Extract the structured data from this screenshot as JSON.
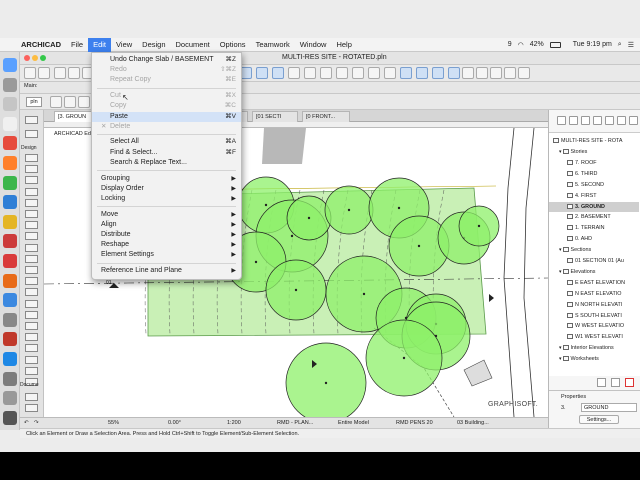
{
  "menubar": {
    "apple": "",
    "app": "ARCHICAD",
    "items": [
      "File",
      "Edit",
      "View",
      "Design",
      "Document",
      "Options",
      "Teamwork",
      "Window",
      "Help"
    ],
    "active": "Edit",
    "right": {
      "notif": "9",
      "battery": "42%",
      "flag": "",
      "time": "Tue 9:19 pm"
    }
  },
  "window": {
    "title": "MULTI-RES SITE - ROTATED.pln"
  },
  "toolbar3": {
    "zoom_select": "pln"
  },
  "toolbox": {
    "info_label": "Main:",
    "design_label": "Design",
    "document_label": "Docume",
    "more_label": "More"
  },
  "tabs": [
    {
      "label": "[3. GROUN",
      "active": true
    },
    {
      "label": "[A1000 Si",
      "active": false
    },
    {
      "label": "[A3000 SE",
      "active": false
    },
    {
      "label": "[0 N NOR",
      "active": false
    },
    {
      "label": "[01 SECTI",
      "active": false
    },
    {
      "label": "[0 FRONT...",
      "active": false
    }
  ],
  "canvas_labels": {
    "info": "ARCHICAD Edu",
    "grid_marker": "01",
    "logo": "GRAPHISOFT."
  },
  "status": {
    "undo": "",
    "zoom": "55%",
    "angle": "0.00°",
    "scale": "1:200",
    "layer_combo": "RMD - PLAN...",
    "model": "Entire Model",
    "pens": "RMD PENS 20",
    "view": "03 Building..."
  },
  "hint": "Click an Element or Draw a Selection Area. Press and Hold Ctrl+Shift to Toggle Element/Sub-Element Selection.",
  "navigator": {
    "root": "MULTI-RES SITE - ROTA",
    "tree": [
      {
        "label": "Stories",
        "level": 1,
        "selected": false
      },
      {
        "label": "7. ROOF",
        "level": 2,
        "selected": false
      },
      {
        "label": "6. THIRD",
        "level": 2,
        "selected": false
      },
      {
        "label": "5. SECOND",
        "level": 2,
        "selected": false
      },
      {
        "label": "4. FIRST",
        "level": 2,
        "selected": false
      },
      {
        "label": "3. GROUND",
        "level": 2,
        "selected": true
      },
      {
        "label": "2. BASEMENT",
        "level": 2,
        "selected": false
      },
      {
        "label": "1. TERRAIN",
        "level": 2,
        "selected": false
      },
      {
        "label": "0. AHD",
        "level": 2,
        "selected": false
      },
      {
        "label": "Sections",
        "level": 1,
        "selected": false
      },
      {
        "label": "01 SECTION 01 (Au",
        "level": 2,
        "selected": false
      },
      {
        "label": "Elevations",
        "level": 1,
        "selected": false
      },
      {
        "label": "E EAST ELEVATION",
        "level": 2,
        "selected": false
      },
      {
        "label": "N EAST ELEVATIO",
        "level": 2,
        "selected": false
      },
      {
        "label": "N NORTH ELEVATI",
        "level": 2,
        "selected": false
      },
      {
        "label": "S SOUTH ELEVATI",
        "level": 2,
        "selected": false
      },
      {
        "label": "W WEST ELEVATIO",
        "level": 2,
        "selected": false
      },
      {
        "label": "W1 WEST ELEVATI",
        "level": 2,
        "selected": false
      },
      {
        "label": "Interior Elevations",
        "level": 1,
        "selected": false
      },
      {
        "label": "Worksheets",
        "level": 1,
        "selected": false
      }
    ]
  },
  "properties": {
    "title": "Properties",
    "story_num": "3.",
    "story_name": "GROUND",
    "settings": "Settings..."
  },
  "edit_menu": {
    "items": [
      {
        "label": "Undo Change Slab / BASEMENT",
        "shortcut": "⌘Z",
        "enabled": true,
        "icon": ""
      },
      {
        "label": "Redo",
        "shortcut": "⇧⌘Z",
        "enabled": false,
        "icon": ""
      },
      {
        "label": "Repeat Copy",
        "shortcut": "⌘E",
        "enabled": false,
        "icon": ""
      },
      {
        "sep": true
      },
      {
        "label": "Cut",
        "shortcut": "⌘X",
        "enabled": false,
        "icon": ""
      },
      {
        "label": "Copy",
        "shortcut": "⌘C",
        "enabled": false,
        "icon": ""
      },
      {
        "label": "Paste",
        "shortcut": "⌘V",
        "enabled": true,
        "icon": "",
        "highlight": true
      },
      {
        "label": "Delete",
        "shortcut": "",
        "enabled": false,
        "icon": "✕"
      },
      {
        "sep": true
      },
      {
        "label": "Select All",
        "shortcut": "⌘A",
        "enabled": true,
        "icon": ""
      },
      {
        "label": "Find & Select...",
        "shortcut": "⌘F",
        "enabled": true,
        "icon": ""
      },
      {
        "label": "Search & Replace Text...",
        "shortcut": "",
        "enabled": true,
        "icon": ""
      },
      {
        "sep": true
      },
      {
        "label": "Grouping",
        "submenu": true,
        "enabled": true
      },
      {
        "label": "Display Order",
        "submenu": true,
        "enabled": true
      },
      {
        "label": "Locking",
        "submenu": true,
        "enabled": true
      },
      {
        "sep": true
      },
      {
        "label": "Move",
        "submenu": true,
        "enabled": true
      },
      {
        "label": "Align",
        "submenu": true,
        "enabled": true
      },
      {
        "label": "Distribute",
        "submenu": true,
        "enabled": true
      },
      {
        "label": "Reshape",
        "submenu": true,
        "enabled": true
      },
      {
        "label": "Element Settings",
        "submenu": true,
        "enabled": true
      },
      {
        "sep": true
      },
      {
        "label": "Reference Line and Plane",
        "submenu": true,
        "enabled": true
      }
    ]
  },
  "colors": {
    "menu_highlight": "#3d80ee",
    "tree_fill": "#8ef06a",
    "hatch_fill": "#c9f0b6"
  }
}
